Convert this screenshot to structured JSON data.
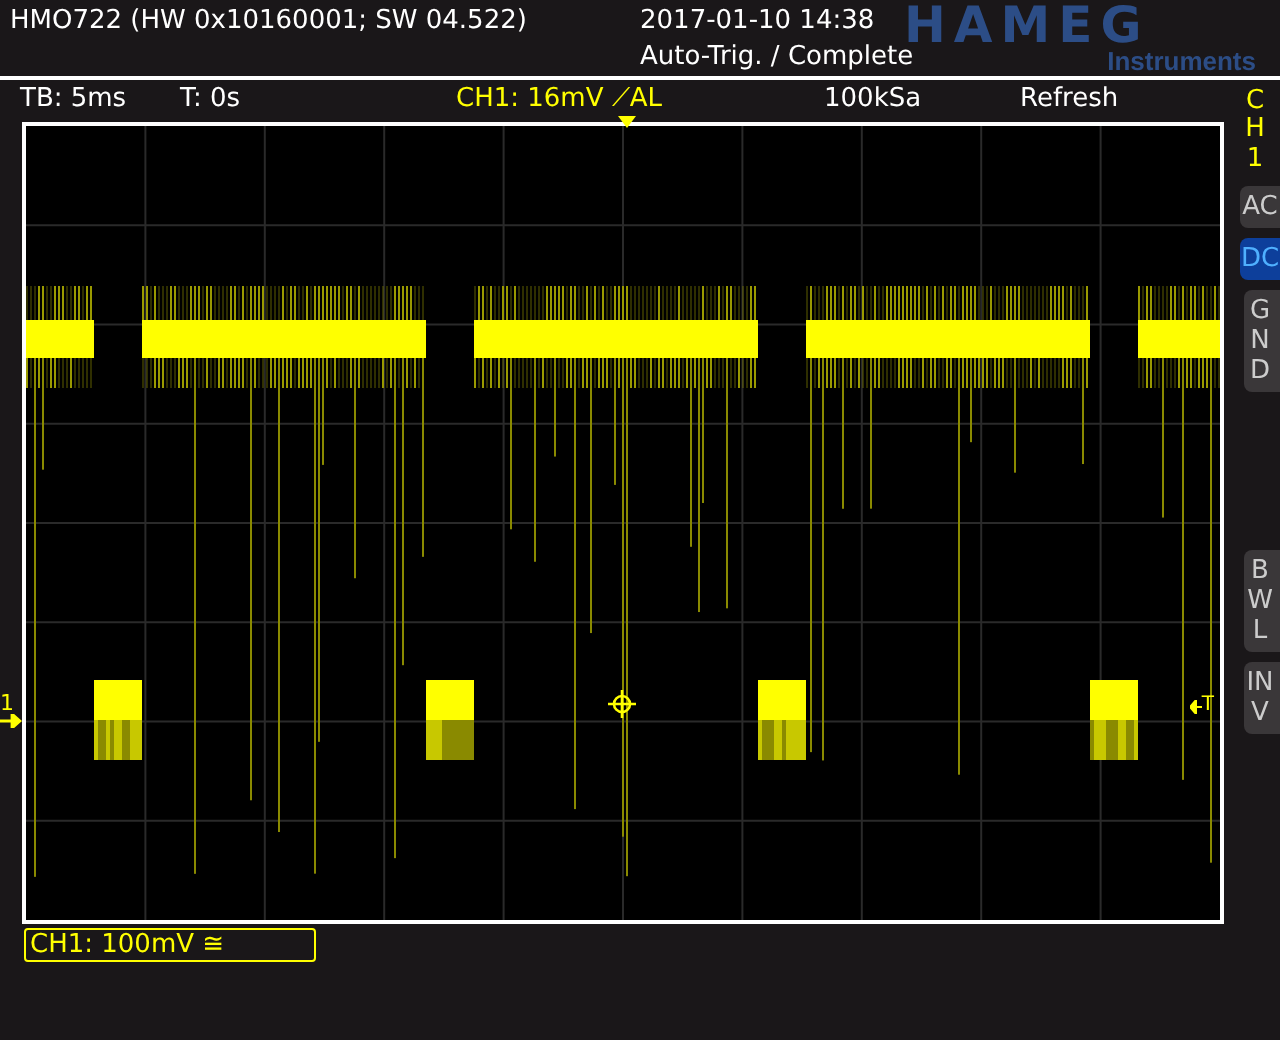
{
  "header": {
    "device": "HMO722 (HW 0x10160001; SW 04.522)",
    "datetime": "2017-01-10 14:38",
    "trigger_status": "Auto-Trig. / Complete",
    "logo": "HAMEG",
    "logo_sub": "Instruments"
  },
  "status_bar": [
    {
      "text": "TB: 5ms",
      "kind": "plain"
    },
    {
      "text": "T: 0s",
      "kind": "plain"
    },
    {
      "text": "CH1: 16mV ⟋AL",
      "kind": "channel"
    },
    {
      "text": "100kSa",
      "kind": "plain"
    },
    {
      "text": "Refresh",
      "kind": "plain"
    }
  ],
  "side_panel": {
    "channel": "CH1",
    "buttons": [
      {
        "label": "AC",
        "selected": false
      },
      {
        "label": "DC",
        "selected": true
      },
      {
        "label": "GND",
        "selected": false
      },
      {
        "label": "BWL",
        "selected": false
      },
      {
        "label": "INV",
        "selected": false
      }
    ]
  },
  "markers": {
    "channel_marker": "1",
    "trigger_level": "T"
  },
  "channel_info": "CH1: 100mV ≅"
}
